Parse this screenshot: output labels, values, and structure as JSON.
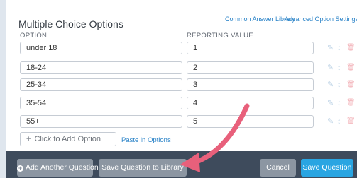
{
  "header": {
    "title": "Multiple Choice Options",
    "links": {
      "common_answer_library": "Common Answer Library",
      "advanced_option_settings": "Advanced Option Settings"
    }
  },
  "columns": {
    "option": "OPTION",
    "reporting_value": "REPORTING VALUE"
  },
  "options": [
    {
      "option": "under 18",
      "reporting_value": "1"
    },
    {
      "option": "18-24",
      "reporting_value": "2"
    },
    {
      "option": "25-34",
      "reporting_value": "3"
    },
    {
      "option": "35-54",
      "reporting_value": "4"
    },
    {
      "option": "55+",
      "reporting_value": "5"
    }
  ],
  "row_action_icons": [
    "pencil-icon",
    "drag-handle-icon",
    "trash-icon"
  ],
  "add_option": {
    "placeholder": "Click to Add Option",
    "paste_link": "Paste in Options"
  },
  "footer": {
    "add_another_question": "Add Another Question",
    "save_to_library": "Save Question to Library",
    "cancel": "Cancel",
    "save_question": "Save Question"
  },
  "colors": {
    "accent_blue": "#29a5e2",
    "footer_bg": "#3e4b5c",
    "annotation_arrow": "#e8607b"
  }
}
